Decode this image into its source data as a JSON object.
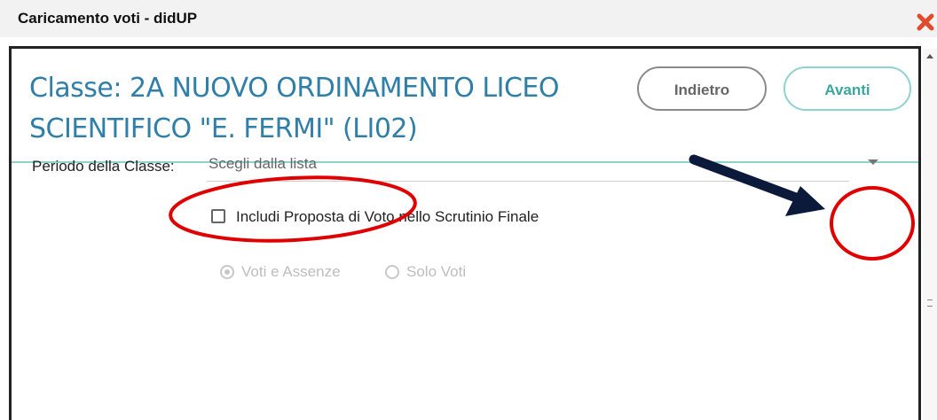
{
  "window": {
    "title": "Caricamento voti - didUP"
  },
  "header": {
    "class_title_line1": "Classe: 2A NUOVO ORDINAMENTO LICEO",
    "class_title_line2": "SCIENTIFICO \"E. FERMI\" (LI02)",
    "back_label": "Indietro",
    "next_label": "Avanti"
  },
  "form": {
    "period_label": "Periodo della Classe:",
    "period_placeholder": "Scegli dalla lista",
    "include_proposal_label": "Includi Proposta di Voto nello Scrutinio Finale",
    "include_proposal_checked": false,
    "radio_options": [
      {
        "label": "Voti e Assenze",
        "selected": true
      },
      {
        "label": "Solo Voti",
        "selected": false
      }
    ]
  },
  "icons": {
    "close": "close-icon",
    "dropdown": "chevron-down-icon",
    "scroll_up": "arrow-up-icon"
  },
  "colors": {
    "title_blue": "#2f7fa8",
    "teal": "#3aa6a0",
    "annotation_red": "#e00000",
    "annotation_arrow": "#0b1a3a"
  }
}
